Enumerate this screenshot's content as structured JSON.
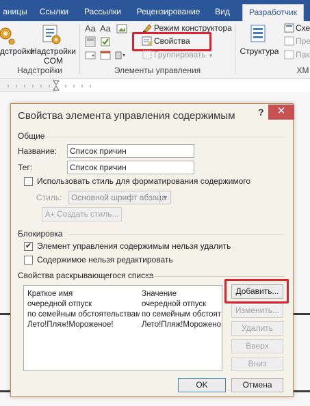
{
  "ribbon": {
    "tabs": [
      {
        "label": "аницы",
        "active": false
      },
      {
        "label": "Ссылки",
        "active": false
      },
      {
        "label": "Рассылки",
        "active": false
      },
      {
        "label": "Рецензирование",
        "active": false
      },
      {
        "label": "Вид",
        "active": false
      },
      {
        "label": "Разработчик",
        "active": true
      }
    ],
    "addins_group": {
      "label": "Надстройки",
      "addins_button": "дстройки",
      "com_addins_line1": "Надстройки",
      "com_addins_line2": "COM"
    },
    "controls_group": {
      "label": "Элементы управления",
      "design_mode": "Режим конструктора",
      "properties": "Свойства",
      "group": "Группировать"
    },
    "xml_group": {
      "label": "XM",
      "structure": "Структура",
      "schema": "Схем",
      "transform": "Пре",
      "packages": "Пак"
    }
  },
  "dialog": {
    "title": "Свойства элемента управления содержимым",
    "help": "?",
    "close": "✕",
    "general": {
      "header": "Общие",
      "title_label": "Название:",
      "title_value": "Список причин",
      "tag_label": "Тег:",
      "tag_value": "Список причин",
      "use_style_label": "Использовать стиль для форматирования содержимого",
      "use_style_checked": false,
      "style_label": "Стиль:",
      "style_value": "Основной шрифт абзаца",
      "new_style_button": "Создать стиль..."
    },
    "locking": {
      "header": "Блокировка",
      "cannot_delete_label": "Элемент управления содержимым нельзя удалить",
      "cannot_delete_checked": true,
      "cannot_edit_label": "Содержимое нельзя редактировать",
      "cannot_edit_checked": false
    },
    "dropdown": {
      "header": "Свойства раскрывающегося списка",
      "col_display": "Краткое имя",
      "col_value": "Значение",
      "rows": [
        {
          "display": "очередной отпуск",
          "value": "очередной отпуск"
        },
        {
          "display": "по семейным обстоятельствам",
          "value": "по семейным обстоятельствам"
        },
        {
          "display": "Лето!Пляж!Мороженое!",
          "value": "Лето!Пляж!Мороженое!"
        }
      ],
      "add_button": "Добавить...",
      "modify_button": "Изменить...",
      "remove_button": "Удалить",
      "up_button": "Вверх",
      "down_button": "Вниз"
    },
    "ok_button": "OK",
    "cancel_button": "Отмена"
  },
  "colors": {
    "ribbon_tab_bg": "#2b579a",
    "highlight": "#d9232e",
    "close_bg": "#c75050"
  }
}
